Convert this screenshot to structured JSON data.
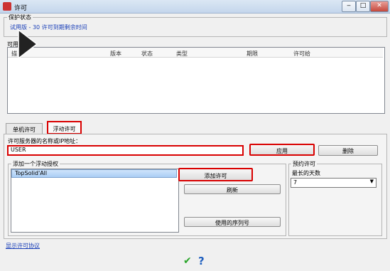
{
  "window": {
    "title": "许可",
    "minimize": "‒",
    "maximize": "□",
    "close": "✕"
  },
  "protection": {
    "title": "保护状态",
    "status": "试用版 - 30 许可到期剩余时间"
  },
  "license_list": {
    "title": "可用",
    "columns": [
      "描",
      "版本",
      "状态",
      "类型",
      "期限",
      "许可给"
    ]
  },
  "tabs": {
    "single": "单机许可",
    "floating": "浮动许可"
  },
  "server": {
    "label": "许可服务器的名称或IP地址：",
    "value": "USER",
    "apply": "应用",
    "delete": "删除"
  },
  "floating_license": {
    "title": "添加一个浮动授权",
    "items": [
      "TopSolid'All"
    ],
    "add": "添加许可",
    "refresh": "刷新",
    "serial": "使用的序列号"
  },
  "reserved": {
    "title": "预约许可",
    "label": "最长的天数",
    "value": "7"
  },
  "footer": {
    "agreement": "显示许可协议",
    "ok_icon": "✔",
    "help_icon": "?"
  },
  "colors": {
    "highlight": "#d90000",
    "ok": "#2aa52a",
    "help": "#1f5fbf",
    "link": "#1a3fb8"
  }
}
